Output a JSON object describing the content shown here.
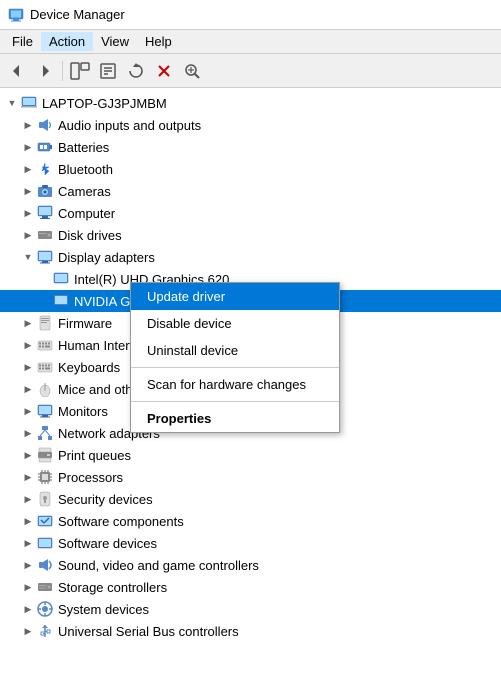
{
  "titleBar": {
    "icon": "💻",
    "title": "Device Manager"
  },
  "menuBar": {
    "items": [
      {
        "id": "file",
        "label": "File"
      },
      {
        "id": "action",
        "label": "Action",
        "active": true
      },
      {
        "id": "view",
        "label": "View"
      },
      {
        "id": "help",
        "label": "Help"
      }
    ]
  },
  "toolbar": {
    "buttons": [
      {
        "id": "back",
        "icon": "◀",
        "disabled": false
      },
      {
        "id": "forward",
        "icon": "▶",
        "disabled": false
      },
      {
        "id": "up",
        "icon": "⬆",
        "disabled": false
      },
      {
        "id": "show-hide",
        "icon": "▦",
        "disabled": false
      },
      {
        "id": "properties",
        "icon": "📋",
        "disabled": false
      },
      {
        "id": "update",
        "icon": "🔃",
        "disabled": false
      },
      {
        "id": "uninstall",
        "icon": "❌",
        "disabled": false
      },
      {
        "id": "scan",
        "icon": "🔍",
        "disabled": false
      }
    ]
  },
  "tree": {
    "items": [
      {
        "id": "laptop",
        "label": "LAPTOP-GJ3PJMBM",
        "icon": "💻",
        "indent": 0,
        "expanded": true,
        "hasExpand": true
      },
      {
        "id": "audio",
        "label": "Audio inputs and outputs",
        "icon": "🔊",
        "indent": 1,
        "expanded": false,
        "hasExpand": true
      },
      {
        "id": "batteries",
        "label": "Batteries",
        "icon": "🔋",
        "indent": 1,
        "expanded": false,
        "hasExpand": true
      },
      {
        "id": "bluetooth",
        "label": "Bluetooth",
        "icon": "🔵",
        "indent": 1,
        "expanded": false,
        "hasExpand": true
      },
      {
        "id": "cameras",
        "label": "Cameras",
        "icon": "📷",
        "indent": 1,
        "expanded": false,
        "hasExpand": true
      },
      {
        "id": "computer",
        "label": "Computer",
        "icon": "🖥",
        "indent": 1,
        "expanded": false,
        "hasExpand": true
      },
      {
        "id": "diskdrives",
        "label": "Disk drives",
        "icon": "💾",
        "indent": 1,
        "expanded": false,
        "hasExpand": true
      },
      {
        "id": "display",
        "label": "Display adapters",
        "icon": "🖥",
        "indent": 1,
        "expanded": true,
        "hasExpand": true
      },
      {
        "id": "intel",
        "label": "Intel(R) UHD Graphics 620",
        "icon": "🖥",
        "indent": 2,
        "expanded": false,
        "hasExpand": false
      },
      {
        "id": "nvidia",
        "label": "NVIDIA GeFor...",
        "icon": "🖥",
        "indent": 2,
        "expanded": false,
        "hasExpand": false,
        "selected": true
      },
      {
        "id": "firmware",
        "label": "Firmware",
        "icon": "📄",
        "indent": 1,
        "expanded": false,
        "hasExpand": true
      },
      {
        "id": "human",
        "label": "Human Interface",
        "icon": "⌨",
        "indent": 1,
        "expanded": false,
        "hasExpand": true
      },
      {
        "id": "keyboards",
        "label": "Keyboards",
        "icon": "⌨",
        "indent": 1,
        "expanded": false,
        "hasExpand": true
      },
      {
        "id": "mice",
        "label": "Mice and other p...",
        "icon": "🖱",
        "indent": 1,
        "expanded": false,
        "hasExpand": true
      },
      {
        "id": "monitors",
        "label": "Monitors",
        "icon": "🖥",
        "indent": 1,
        "expanded": false,
        "hasExpand": true
      },
      {
        "id": "network",
        "label": "Network adapters",
        "icon": "🌐",
        "indent": 1,
        "expanded": false,
        "hasExpand": true
      },
      {
        "id": "printqueues",
        "label": "Print queues",
        "icon": "🖨",
        "indent": 1,
        "expanded": false,
        "hasExpand": true
      },
      {
        "id": "processors",
        "label": "Processors",
        "icon": "⚙",
        "indent": 1,
        "expanded": false,
        "hasExpand": true
      },
      {
        "id": "security",
        "label": "Security devices",
        "icon": "🔒",
        "indent": 1,
        "expanded": false,
        "hasExpand": true
      },
      {
        "id": "softwarecomp",
        "label": "Software components",
        "icon": "📦",
        "indent": 1,
        "expanded": false,
        "hasExpand": true
      },
      {
        "id": "softwaredev",
        "label": "Software devices",
        "icon": "📦",
        "indent": 1,
        "expanded": false,
        "hasExpand": true
      },
      {
        "id": "sound",
        "label": "Sound, video and game controllers",
        "icon": "🔊",
        "indent": 1,
        "expanded": false,
        "hasExpand": true
      },
      {
        "id": "storage",
        "label": "Storage controllers",
        "icon": "💾",
        "indent": 1,
        "expanded": false,
        "hasExpand": true
      },
      {
        "id": "system",
        "label": "System devices",
        "icon": "⚙",
        "indent": 1,
        "expanded": false,
        "hasExpand": true
      },
      {
        "id": "usb",
        "label": "Universal Serial Bus controllers",
        "icon": "🔌",
        "indent": 1,
        "expanded": false,
        "hasExpand": true
      }
    ]
  },
  "contextMenu": {
    "visible": true,
    "items": [
      {
        "id": "update-driver",
        "label": "Update driver",
        "highlighted": true,
        "bold": false
      },
      {
        "id": "disable-device",
        "label": "Disable device",
        "highlighted": false,
        "bold": false
      },
      {
        "id": "uninstall-device",
        "label": "Uninstall device",
        "highlighted": false,
        "bold": false
      },
      {
        "id": "sep1",
        "separator": true
      },
      {
        "id": "scan-changes",
        "label": "Scan for hardware changes",
        "highlighted": false,
        "bold": false
      },
      {
        "id": "sep2",
        "separator": true
      },
      {
        "id": "properties",
        "label": "Properties",
        "highlighted": false,
        "bold": true
      }
    ]
  },
  "icons": {
    "expand": "▶",
    "collapse": "▼",
    "computer": "💻"
  }
}
